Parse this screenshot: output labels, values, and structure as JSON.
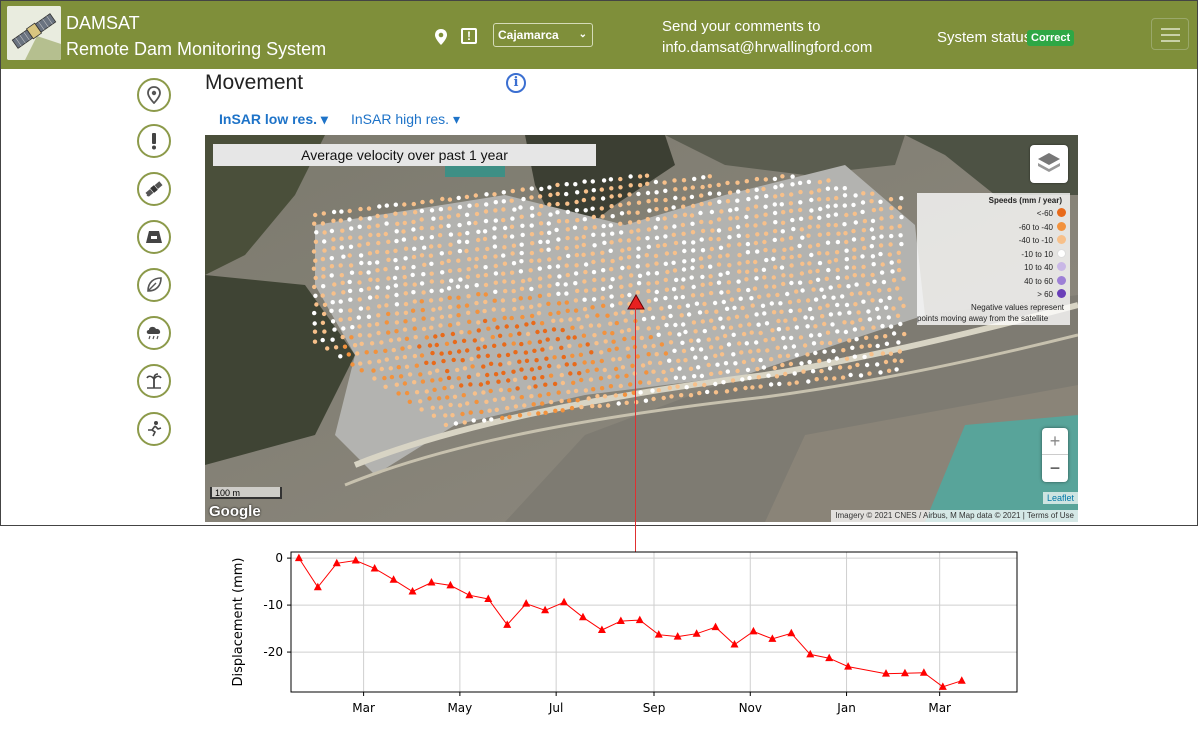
{
  "header": {
    "app_name": "DAMSAT",
    "app_subtitle": "Remote Dam Monitoring System",
    "site_selected": "Cajamarca",
    "comments_line1": "Send your comments to",
    "comments_line2": "info.damsat@hrwallingford.com",
    "status_label": "System status:",
    "status_value": "Correct",
    "status_color": "#2ea745",
    "brand_color": "#7f8f3a",
    "icons": [
      "satellite-logo-icon",
      "map-pin-icon",
      "alert-icon",
      "chevron-down-icon",
      "hamburger-menu-icon"
    ]
  },
  "sidebar": {
    "items": [
      {
        "name": "location",
        "icon": "map-pin-icon"
      },
      {
        "name": "alerts",
        "icon": "exclamation-icon"
      },
      {
        "name": "movement",
        "icon": "satellite-icon"
      },
      {
        "name": "dam",
        "icon": "dam-icon"
      },
      {
        "name": "vegetation",
        "icon": "leaf-icon"
      },
      {
        "name": "weather",
        "icon": "rain-cloud-icon"
      },
      {
        "name": "environment",
        "icon": "palm-tree-icon"
      },
      {
        "name": "activity",
        "icon": "running-person-icon"
      }
    ]
  },
  "main": {
    "title": "Movement",
    "tabs": [
      {
        "label": "InSAR low res. ▾",
        "active": true
      },
      {
        "label": "InSAR high res. ▾",
        "active": false
      }
    ],
    "map": {
      "title": "Average velocity over past 1 year",
      "legend": {
        "title": "Speeds (mm / year)",
        "items": [
          {
            "label": "<-60",
            "color": "#e86a1a"
          },
          {
            "label": "-60 to -40",
            "color": "#f2923d"
          },
          {
            "label": "-40 to -10",
            "color": "#f7c08a"
          },
          {
            "label": "-10 to 10",
            "color": "#ffffff"
          },
          {
            "label": "10 to 40",
            "color": "#c9b7e6"
          },
          {
            "label": "40 to 60",
            "color": "#9d7fd6"
          },
          {
            "label": "> 60",
            "color": "#6a3fb8"
          }
        ],
        "note_line1": "Negative values represent",
        "note_line2": "points moving away from the satellite"
      },
      "zoom_in": "+",
      "zoom_out": "−",
      "scale": "100 m",
      "google": "Google",
      "leaflet": "Leaflet",
      "attribution": "Imagery © 2021 CNES / Airbus, M  Map data © 2021  |  Terms of Use"
    }
  },
  "chart_data": {
    "type": "line",
    "ylabel": "Displacement (mm)",
    "xlabel": "",
    "ylim": [
      -28.5,
      1.3
    ],
    "yticks": [
      0,
      -10,
      -20
    ],
    "xticks": [
      "Mar",
      "May",
      "Jul",
      "Sep",
      "Nov",
      "Jan",
      "Mar"
    ],
    "xtick_days": [
      41,
      102,
      163,
      225,
      286,
      347,
      406
    ],
    "xlim": [
      -5,
      455
    ],
    "grid": true,
    "color": "#ff0000",
    "marker": "triangle",
    "series": [
      {
        "x": [
          0,
          12,
          24,
          36,
          48,
          60,
          72,
          84,
          96,
          108,
          120,
          132,
          144,
          156,
          168,
          180,
          192,
          204,
          216,
          228,
          240,
          252,
          264,
          276,
          288,
          300,
          312,
          324,
          336,
          348,
          372,
          384,
          396,
          408,
          420
        ],
        "y": [
          0,
          -6.2,
          -1.1,
          -0.5,
          -2.2,
          -4.6,
          -7.1,
          -5.2,
          -5.8,
          -7.9,
          -8.7,
          -14.2,
          -9.7,
          -11.1,
          -9.4,
          -12.6,
          -15.3,
          -13.4,
          -13.2,
          -16.3,
          -16.7,
          -16.1,
          -14.7,
          -18.4,
          -15.6,
          -17.2,
          -16.0,
          -20.5,
          -21.3,
          -23.1,
          -24.6,
          -24.5,
          -24.4,
          -27.4,
          -26.1
        ]
      }
    ]
  }
}
